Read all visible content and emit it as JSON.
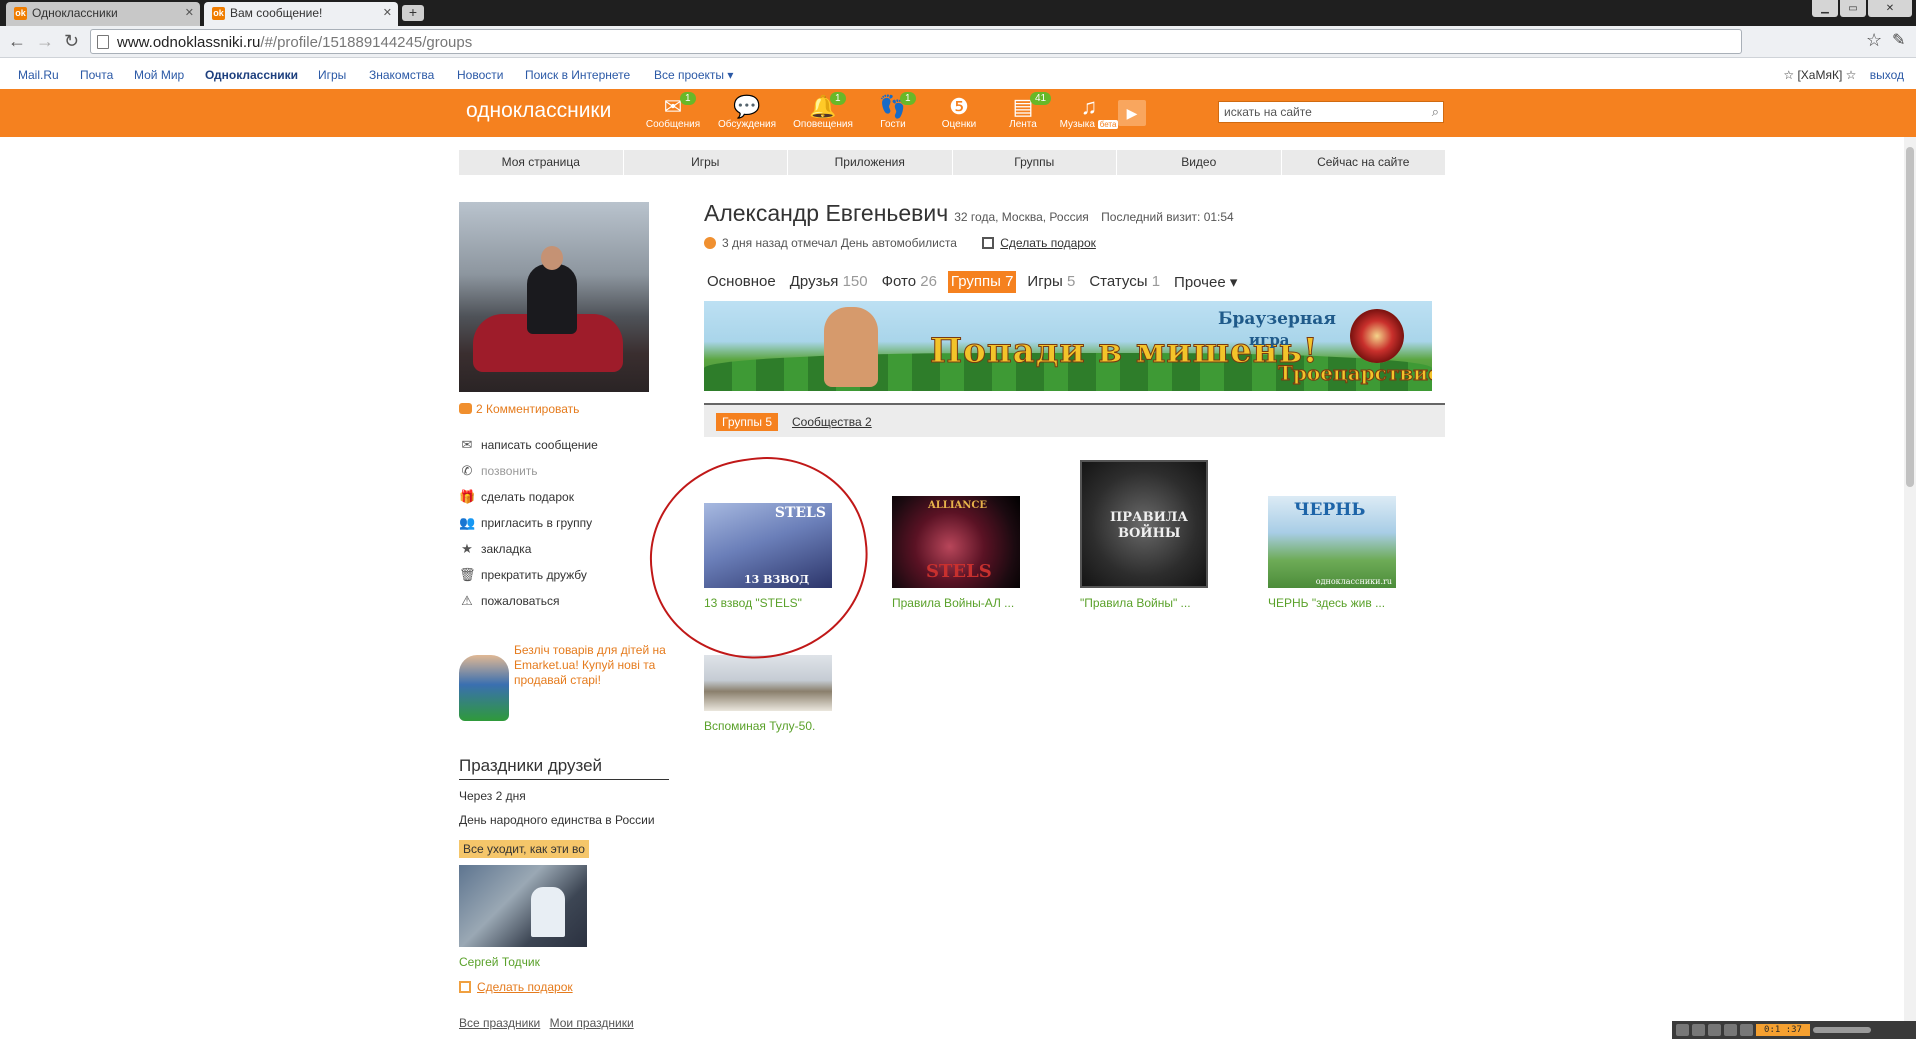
{
  "browser": {
    "tabs": [
      {
        "label": "Одноклассники"
      },
      {
        "label": "Вам сообщение!"
      }
    ],
    "url_host": "www.odnoklassniki.ru",
    "url_path": "/#/profile/151889144245/groups"
  },
  "portal": {
    "links": [
      "Mail.Ru",
      "Почта",
      "Мой Мир",
      "Одноклассники",
      "Игры",
      "Знакомства",
      "Новости",
      "Поиск в Интернете",
      "Все проекты ▾"
    ],
    "user": "☆ [ХаМяК] ☆",
    "logout": "выход"
  },
  "header": {
    "logo": "одноклассники",
    "icons": [
      {
        "label": "Сообщения",
        "badge": "1",
        "icon": "envelope-icon"
      },
      {
        "label": "Обсуждения",
        "badge": "",
        "icon": "speech-bubbles-icon"
      },
      {
        "label": "Оповещения",
        "badge": "1",
        "icon": "bell-icon"
      },
      {
        "label": "Гости",
        "badge": "1",
        "icon": "footprints-icon"
      },
      {
        "label": "Оценки",
        "badge": "",
        "icon": "five-rating-icon"
      },
      {
        "label": "Лента",
        "badge": "41",
        "icon": "feed-icon"
      },
      {
        "label": "Музыка",
        "badge": "",
        "icon": "music-note-icon"
      }
    ],
    "beta": "бета",
    "search_placeholder": "искать на сайте"
  },
  "mainnav": [
    "Моя страница",
    "Игры",
    "Приложения",
    "Группы",
    "Видео",
    "Сейчас на сайте"
  ],
  "sidebar": {
    "comments": "2 Комментировать",
    "actions": [
      {
        "label": "написать сообщение",
        "icon": "envelope-icon",
        "disabled": false
      },
      {
        "label": "позвонить",
        "icon": "phone-icon",
        "disabled": true
      },
      {
        "label": "сделать подарок",
        "icon": "gift-icon",
        "disabled": false
      },
      {
        "label": "пригласить в группу",
        "icon": "group-icon",
        "disabled": false
      },
      {
        "label": "закладка",
        "icon": "star-icon",
        "disabled": false
      },
      {
        "label": "прекратить дружбу",
        "icon": "trash-icon",
        "disabled": false
      },
      {
        "label": "пожаловаться",
        "icon": "warning-icon",
        "disabled": false
      }
    ],
    "promo": "Безліч товарів для дітей на Emarket.ua! Купуй нові та продавай старі!",
    "holidays": {
      "title": "Праздники друзей",
      "when": "Через 2 дня",
      "holiday": "День народного единства в России",
      "badge": "Все уходит, как эти во",
      "friend": "Сергей Тодчик",
      "gift": "Сделать подарок",
      "all": "Все праздники",
      "mine": "Мои праздники"
    }
  },
  "profile": {
    "name": "Александр Евгеньевич",
    "meta": "32 года, Москва, Россия",
    "last_visit": "Последний визит: 01:54",
    "status": "3 дня назад отмечал День автомобилиста",
    "gift": "Сделать подарок",
    "tabs": [
      {
        "label": "Основное",
        "count": ""
      },
      {
        "label": "Друзья",
        "count": "150"
      },
      {
        "label": "Фото",
        "count": "26"
      },
      {
        "label": "Группы",
        "count": "7"
      },
      {
        "label": "Игры",
        "count": "5"
      },
      {
        "label": "Статусы",
        "count": "1"
      },
      {
        "label": "Прочее ▾",
        "count": ""
      }
    ]
  },
  "banner": {
    "slogan": "Попади в мишень!",
    "tag1": "Браузерная",
    "tag2": "игра",
    "game": "Троецарствие"
  },
  "groups": {
    "tab_active": "Группы 5",
    "tab_other": "Сообщества 2",
    "items": [
      {
        "name": "13 взвод \"STELS\"",
        "thumb_top": "STELS",
        "thumb_bottom": "13 ВЗВОД"
      },
      {
        "name": "Правила Войны-АЛ ...",
        "thumb_top": "ALLIANCE",
        "thumb_bottom": "STELS"
      },
      {
        "name": "\"Правила Войны\" ...",
        "thumb_top": "ПРАВИЛА",
        "thumb_bottom": "ВОЙНЫ"
      },
      {
        "name": "ЧЕРНЬ \"здесь жив ...",
        "thumb_top": "ЧЕРНЬ",
        "thumb_bottom": "одноклассники.ru"
      },
      {
        "name": "Вспоминая Тулу-50."
      }
    ]
  },
  "player": {
    "time": "0:1 :37"
  },
  "colors": {
    "brand_orange": "#f5811f",
    "group_green": "#5aa12a",
    "annotation_red": "#c01818"
  }
}
